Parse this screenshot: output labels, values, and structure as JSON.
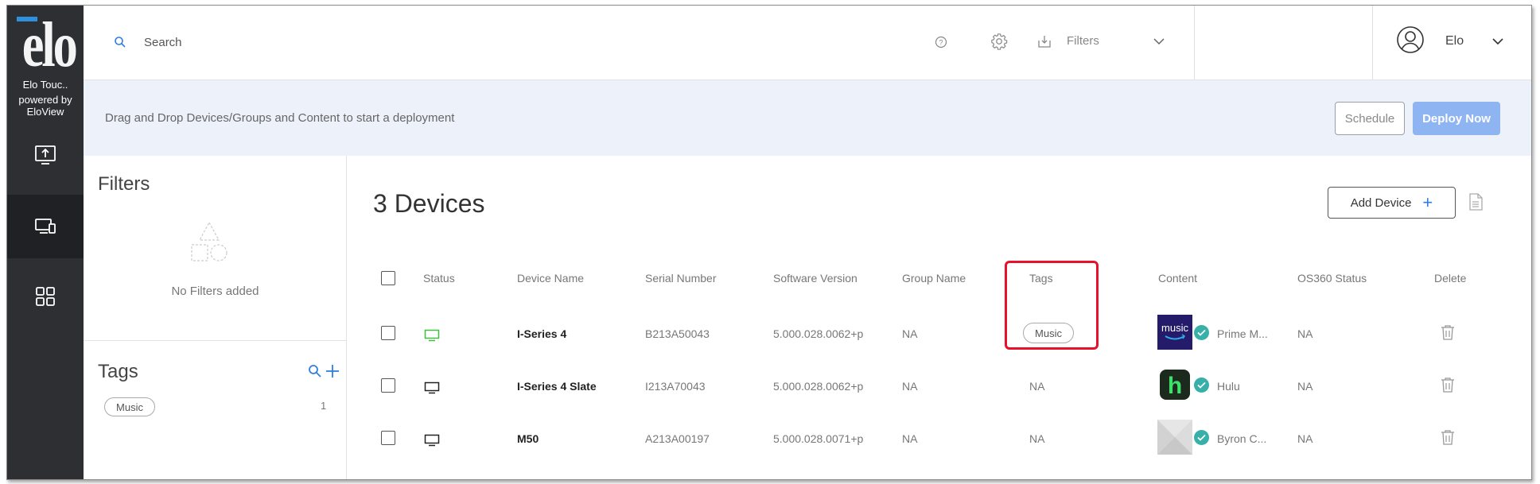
{
  "sidebar": {
    "logo_text": "elo",
    "org_name": "Elo Touc..",
    "powered_by": "powered by EloView",
    "nav": [
      {
        "name": "upload-icon"
      },
      {
        "name": "devices-icon",
        "active": true
      },
      {
        "name": "apps-grid-icon"
      }
    ]
  },
  "topbar": {
    "search_placeholder": "Search",
    "filters_label": "Filters",
    "user_name": "Elo"
  },
  "banner": {
    "text": "Drag and Drop Devices/Groups and Content to start a deployment",
    "schedule_label": "Schedule",
    "deploy_label": "Deploy Now"
  },
  "left_panel": {
    "filters_title": "Filters",
    "no_filters_text": "No Filters added",
    "tags_title": "Tags",
    "tags": [
      {
        "label": "Music",
        "count": "1"
      }
    ]
  },
  "main": {
    "device_count_title": "3 Devices",
    "add_device_label": "Add Device",
    "columns": [
      "Status",
      "Device Name",
      "Serial Number",
      "Software Version",
      "Group Name",
      "Tags",
      "Content",
      "OS360 Status",
      "Delete"
    ],
    "rows": [
      {
        "status": "online",
        "device_name": "I-Series 4",
        "serial": "B213A50043",
        "software": "5.000.028.0062+p",
        "group": "NA",
        "tag": "Music",
        "content_icon": "music",
        "content_name": "Prime M...",
        "os360": "NA"
      },
      {
        "status": "offline",
        "device_name": "I-Series 4 Slate",
        "serial": "I213A70043",
        "software": "5.000.028.0062+p",
        "group": "NA",
        "tag": "NA",
        "content_icon": "h",
        "content_name": "Hulu",
        "os360": "NA"
      },
      {
        "status": "offline",
        "device_name": "M50",
        "serial": "A213A00197",
        "software": "5.000.028.0071+p",
        "group": "NA",
        "tag": "NA",
        "content_icon": "",
        "content_name": "Byron C...",
        "os360": "NA"
      }
    ]
  },
  "colors": {
    "sidebar_bg": "#2d2f33",
    "banner_bg": "#edf1fa",
    "deploy_button": "#8fb4f2",
    "accent_blue": "#2e7fe0",
    "status_online": "#3fbf3f",
    "check_badge": "#36b0a8",
    "highlight": "#e8102a"
  }
}
